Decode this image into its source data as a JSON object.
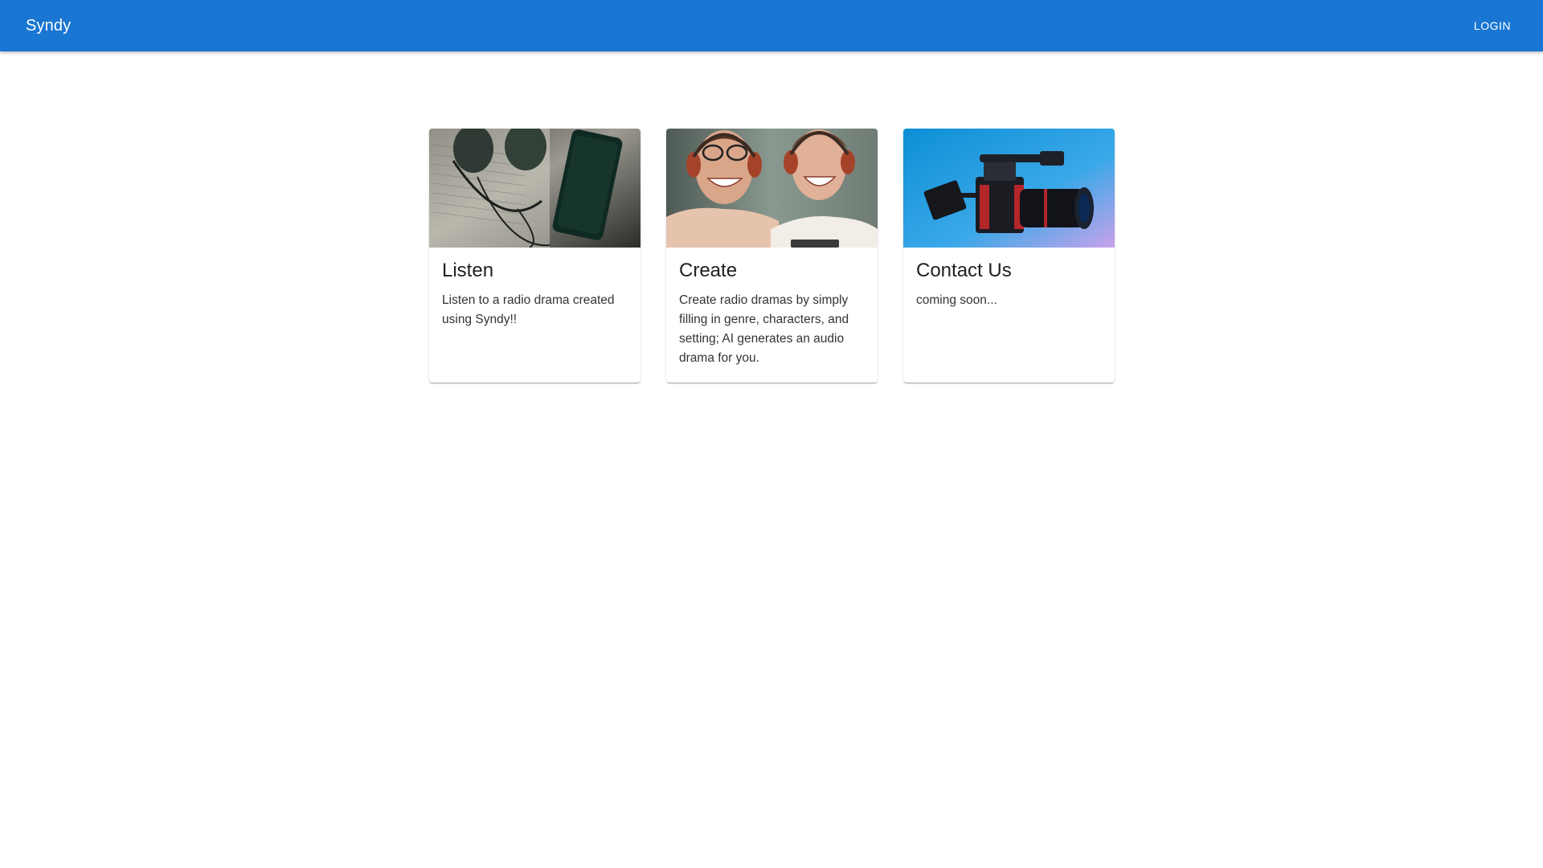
{
  "appbar": {
    "brand": "Syndy",
    "login_label": "LOGIN"
  },
  "cards": [
    {
      "title": "Listen",
      "body": "Listen to a radio drama created using Syndy!!",
      "image": "headphones-and-phone-image"
    },
    {
      "title": "Create",
      "body": "Create radio dramas by simply filling in genre, characters, and setting; AI generates an audio drama for you.",
      "image": "two-men-with-headphones-image"
    },
    {
      "title": "Contact Us",
      "body": "coming soon...",
      "image": "video-camera-image"
    }
  ],
  "colors": {
    "appbar": "#1976d2",
    "background": "#ffffff"
  }
}
